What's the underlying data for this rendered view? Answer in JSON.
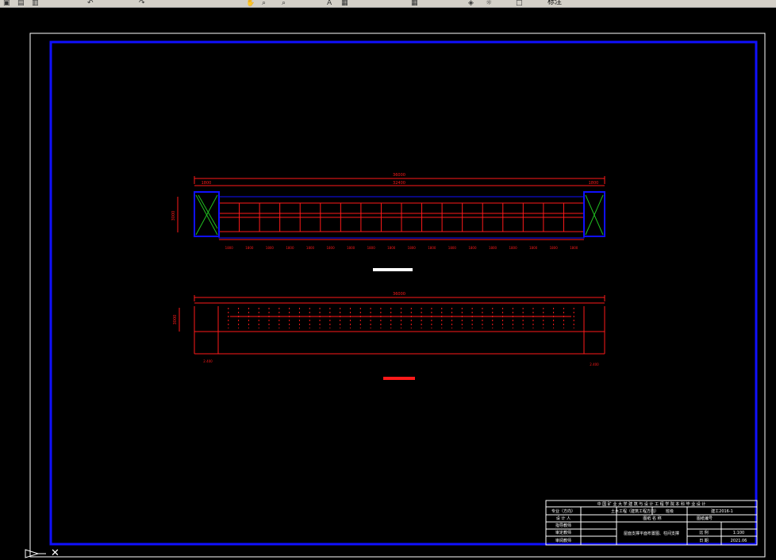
{
  "toolbar": {
    "layer_name": "标注",
    "icons": [
      "open-icon",
      "save-icon",
      "print-icon",
      "undo-icon",
      "redo-icon",
      "pan-icon",
      "zoom-icon",
      "zoom-window-icon",
      "text-icon",
      "properties-icon",
      "table-icon",
      "layer-icon",
      "layer-state-icon",
      "color-icon"
    ]
  },
  "colors": {
    "frame_outer": "#ffffff",
    "frame_inner": "#1010ff",
    "drawing": "#ff1a1a",
    "column": "#1010ff",
    "brace": "#20c020",
    "label": "#ffffff"
  },
  "drawing": {
    "plan": {
      "overall_dim": "36000",
      "inner_dim": "32400",
      "left_dim": "1800",
      "right_dim": "1800",
      "height_dim": "3000",
      "bay_dims": [
        "1800",
        "1800",
        "1800",
        "1800",
        "1800",
        "1800",
        "1800",
        "1800",
        "1800",
        "1800",
        "1800",
        "1800",
        "1800",
        "1800",
        "1800",
        "1800",
        "1800",
        "1800"
      ],
      "title_bar": ""
    },
    "elevation": {
      "overall_dim": "36000",
      "height_dim": "3000",
      "left_note": "2.400",
      "right_note": "2.400",
      "title_bar": ""
    }
  },
  "title_block": {
    "school_row": "中 国 矿 业 大 学 建 筑 与 设 计 工 程 学 院 本 科 毕 业 设 计",
    "rows": [
      [
        "专业（方向）",
        "土木工程（建筑工程方向）",
        "班级",
        "",
        "建工2016-1"
      ],
      [
        "设 计 人",
        "",
        "图纸 名 称",
        "",
        "图纸编号"
      ],
      [
        "指导教师",
        "",
        "",
        "",
        ""
      ],
      [
        "审定教师",
        "",
        "",
        "比 例",
        "1:100"
      ],
      [
        "审阅教师",
        "",
        "",
        "日 期",
        "2021.06"
      ]
    ],
    "drawing_name": "屋面支撑平面布置图、柱间支撑",
    "project": "图 纸 名 称"
  }
}
